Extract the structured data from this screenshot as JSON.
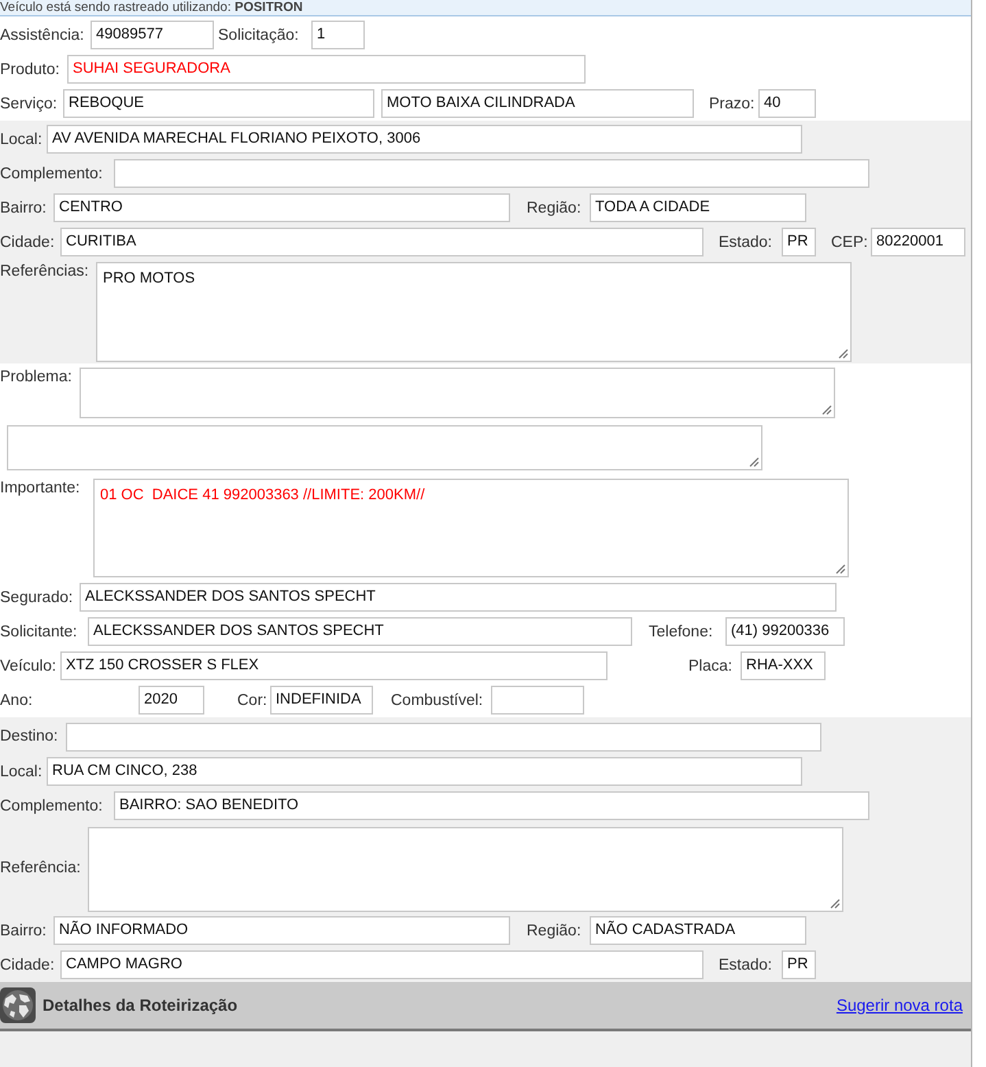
{
  "tracking_notice": "Veículo está sendo rastreado utilizando: **POSITRON**",
  "sections": [
    {
      "rows": [
        {
          "fields": [
            {
              "label": "Assistência:",
              "kind": "input",
              "value": "49089577"
            },
            {
              "label": "Solicitação:",
              "kind": "input",
              "value": "1"
            }
          ]
        },
        {
          "fields": [
            {
              "label": "Produto:",
              "kind": "input",
              "value": "SUHAI SEGURADORA",
              "color": "#ff0000"
            }
          ]
        },
        {
          "fields": [
            {
              "label": "Serviço:",
              "kind": "input",
              "value": "REBOQUE"
            },
            {
              "kind": "input",
              "value": "MOTO BAIXA CILINDRADA"
            },
            {
              "label": "Prazo:",
              "kind": "input",
              "value": "40"
            }
          ]
        }
      ]
    },
    {
      "rows": [
        {
          "fields": [
            {
              "label": "Local:",
              "kind": "input",
              "value": "AV AVENIDA MARECHAL FLORIANO PEIXOTO, 3006"
            }
          ]
        },
        {
          "fields": [
            {
              "label": "Complemento:",
              "kind": "input"
            }
          ]
        },
        {
          "fields": [
            {
              "label": "Bairro:",
              "kind": "input",
              "value": "CENTRO"
            },
            {
              "label": "Região:",
              "kind": "input",
              "value": "TODA A CIDADE"
            }
          ]
        },
        {
          "fields": [
            {
              "label": "Cidade:",
              "kind": "input",
              "value": "CURITIBA"
            },
            {
              "label": "Estado:",
              "kind": "input",
              "value": "PR"
            },
            {
              "label": "CEP:",
              "kind": "input",
              "value": "80220001"
            }
          ]
        },
        {
          "fields": [
            {
              "label": "Referências:",
              "kind": "textarea",
              "value": "PRO MOTOS"
            }
          ]
        }
      ]
    },
    {
      "rows": [
        {
          "fields": [
            {
              "label": "Problema:",
              "kind": "textarea"
            }
          ]
        },
        {
          "fields": [
            {
              "kind": "textarea"
            }
          ]
        },
        {
          "fields": [
            {
              "label": "Importante:",
              "kind": "textarea",
              "value": "01 OC  DAICE 41 992003363 //LIMITE: 200KM//",
              "color": "#ff0000"
            }
          ]
        },
        {
          "fields": [
            {
              "label": "Segurado:",
              "kind": "input",
              "value": "ALECKSSANDER DOS SANTOS SPECHT"
            }
          ]
        },
        {
          "fields": [
            {
              "label": "Solicitante:",
              "kind": "input",
              "value": "ALECKSSANDER DOS SANTOS SPECHT"
            },
            {
              "label": "Telefone:",
              "kind": "input",
              "value": "(41) 99200336"
            }
          ]
        },
        {
          "fields": [
            {
              "label": "Veículo:",
              "kind": "input",
              "value": "XTZ 150 CROSSER S FLEX"
            },
            {
              "label": "Placa:",
              "kind": "input",
              "value": "RHA-XXX"
            }
          ]
        },
        {
          "fields": [
            {
              "label": "Ano:",
              "kind": "input",
              "value": "2020"
            },
            {
              "label": "Cor:",
              "kind": "input",
              "value": "INDEFINIDA"
            },
            {
              "label": "Combustível:",
              "kind": "input"
            }
          ]
        }
      ]
    },
    {
      "rows": [
        {
          "fields": [
            {
              "label": "Destino:",
              "kind": "input"
            }
          ]
        },
        {
          "fields": [
            {
              "label": "Local:",
              "kind": "input",
              "value": "RUA CM CINCO, 238"
            }
          ]
        },
        {
          "fields": [
            {
              "label": "Complemento:",
              "kind": "input",
              "value": "BAIRRO: SAO BENEDITO"
            }
          ]
        },
        {
          "fields": [
            {
              "label": "Referência:",
              "kind": "textarea"
            }
          ]
        },
        {
          "fields": [
            {
              "label": "Bairro:",
              "kind": "input",
              "value": "NÃO INFORMADO"
            },
            {
              "label": "Região:",
              "kind": "input",
              "value": "NÃO CADASTRADA"
            }
          ]
        },
        {
          "fields": [
            {
              "label": "Cidade:",
              "kind": "input",
              "value": "CAMPO MAGRO"
            },
            {
              "label": "Estado:",
              "kind": "input",
              "value": "PR"
            }
          ]
        }
      ]
    }
  ],
  "routing_panel": {
    "title": "Detalhes da Roteirização",
    "link": "Sugerir nova rota"
  }
}
